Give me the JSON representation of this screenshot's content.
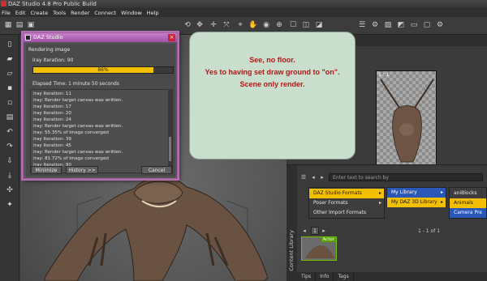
{
  "app": {
    "title": "DAZ Studio 4.8 Pro Public Build",
    "menu": [
      "File",
      "Edit",
      "Create",
      "Tools",
      "Render",
      "Connect",
      "Window",
      "Help"
    ]
  },
  "viewport": {
    "aux_label": "1 : 1"
  },
  "render_dialog": {
    "title": "DAZ Studio",
    "status": "Rendering image",
    "iteration": "Iray Iteration: 90",
    "progress_percent": 86,
    "progress_label": "86%",
    "elapsed": "Elapsed Time: 1 minute 50 seconds",
    "log": [
      "Iray Iteration: 11",
      "Iray: Render target canvas was written.",
      "Iray Iteration: 17",
      "Iray Iteration: 20",
      "Iray Iteration: 24",
      "Iray: Render target canvas was written.",
      "Iray: 55.35% of image converged",
      "Iray Iteration: 39",
      "Iray Iteration: 45",
      "Iray: Render target canvas was written.",
      "Iray: 81.72% of image converged",
      "Iray Iteration: 90"
    ],
    "buttons": {
      "minimize": "Minimize",
      "history": "History >>",
      "cancel": "Cancel"
    }
  },
  "note": {
    "lines": [
      "See, no floor.",
      "Yes to having set draw ground to \"on\".",
      "Scene only render."
    ],
    "text_color": "#b11818",
    "background": "#c9decd"
  },
  "content_library": {
    "tab_label": "Content Library",
    "search_placeholder": "Enter text to search by",
    "menu1": [
      {
        "label": "DAZ Studio Formats",
        "state": "selected"
      },
      {
        "label": "Poser Formats",
        "state": "normal"
      },
      {
        "label": "Other Import Formats",
        "state": "normal"
      }
    ],
    "menu2": [
      {
        "label": "My Library",
        "state": "highlighted"
      },
      {
        "label": "My DAZ 3D Library",
        "state": "selected"
      }
    ],
    "menu3": [
      {
        "label": "aniBlocks",
        "state": "normal"
      },
      {
        "label": "Animals",
        "state": "selected"
      },
      {
        "label": "Camera Pre",
        "state": "highlighted"
      }
    ],
    "pager": "1",
    "count": "1 - 1 of 1",
    "thumbnail_tag": "Actor",
    "bottom_tabs": [
      "Tips",
      "Info",
      "Tags"
    ]
  }
}
